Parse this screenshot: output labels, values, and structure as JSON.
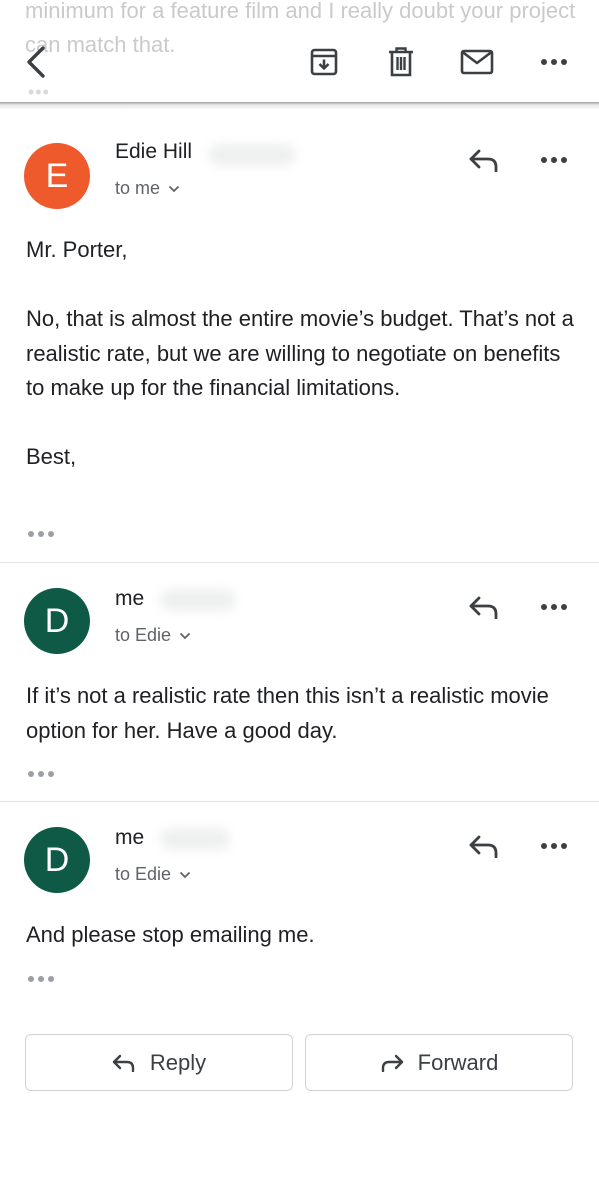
{
  "previous_message": {
    "text": "minimum for a feature film and I really doubt your project can match that."
  },
  "toolbar": {
    "back_icon": "chevron-left-icon",
    "archive_icon": "archive-icon",
    "delete_icon": "trash-icon",
    "mark_unread_icon": "mail-icon",
    "more_icon": "more-horizontal-icon"
  },
  "messages": [
    {
      "avatar_letter": "E",
      "avatar_color": "#ee5a2b",
      "sender": "Edie Hill",
      "recipient": "to me",
      "paragraphs": [
        "Mr. Porter,",
        "No, that is almost the entire movie’s budget. That’s not a realistic rate, but we are willing to negotiate on benefits to make up for the financial limitations.",
        "Best,"
      ]
    },
    {
      "avatar_letter": "D",
      "avatar_color": "#0f5a47",
      "sender": "me",
      "recipient": "to Edie",
      "paragraphs": [
        "If it’s not a realistic rate then this isn’t a realistic movie option for her. Have a good day."
      ]
    },
    {
      "avatar_letter": "D",
      "avatar_color": "#0f5a47",
      "sender": "me",
      "recipient": "to Edie",
      "paragraphs": [
        "And please stop emailing me."
      ]
    }
  ],
  "actions": {
    "reply_label": "Reply",
    "forward_label": "Forward"
  }
}
